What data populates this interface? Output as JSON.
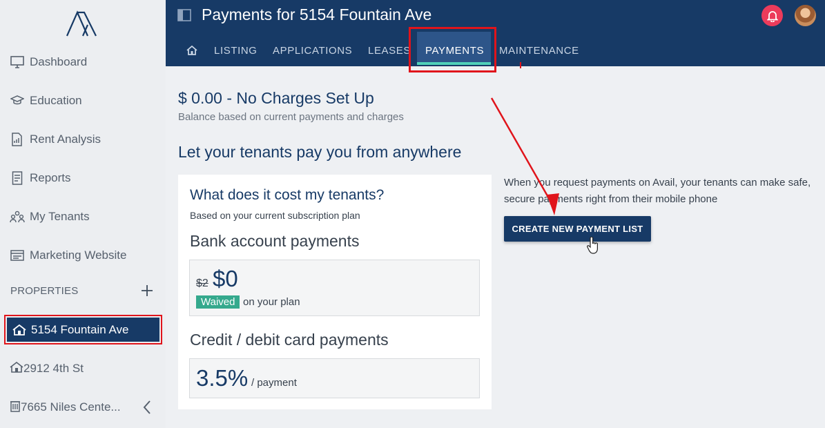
{
  "sidebar": {
    "items": [
      {
        "label": "Dashboard",
        "icon": "monitor-icon"
      },
      {
        "label": "Education",
        "icon": "graduation-cap-icon"
      },
      {
        "label": "Rent Analysis",
        "icon": "document-chart-icon"
      },
      {
        "label": "Reports",
        "icon": "report-document-icon"
      },
      {
        "label": "My Tenants",
        "icon": "people-icon"
      },
      {
        "label": "Marketing Website",
        "icon": "website-icon"
      }
    ],
    "properties_title": "PROPERTIES",
    "properties": [
      {
        "label": "5154 Fountain Ave",
        "icon": "house-icon",
        "active": true
      },
      {
        "label": "2912 4th St",
        "icon": "house-icon"
      },
      {
        "label": "7665 Niles Cente...",
        "icon": "building-icon"
      }
    ]
  },
  "header": {
    "title": "Payments for 5154 Fountain Ave",
    "tabs": [
      {
        "label": "LISTING"
      },
      {
        "label": "APPLICATIONS"
      },
      {
        "label": "LEASES"
      },
      {
        "label": "PAYMENTS",
        "active": true
      },
      {
        "label": "MAINTENANCE"
      }
    ]
  },
  "main": {
    "balance": "$ 0.00 - No Charges Set Up",
    "balance_sub": "Balance based on current payments and charges",
    "headline": "Let your tenants pay you from anywhere",
    "cost_card": {
      "title": "What does it cost my tenants?",
      "subtitle": "Based on your current subscription plan",
      "bank": {
        "title": "Bank account payments",
        "old_price": "$2",
        "new_price": "$0",
        "badge": "Waived",
        "note": "on your plan"
      },
      "card": {
        "title": "Credit / debit card payments",
        "rate": "3.5%",
        "unit": "/ payment"
      }
    },
    "request_text": "When you request payments on Avail, your tenants can make safe, secure payments right from their mobile phone",
    "cta_label": "CREATE NEW PAYMENT LIST"
  },
  "colors": {
    "brand_navy": "#173a66",
    "tab_active_accent": "#4fd1b9",
    "badge_green": "#35a98d",
    "notification_red": "#ec3b5b",
    "annotation_red": "#e0141b"
  }
}
